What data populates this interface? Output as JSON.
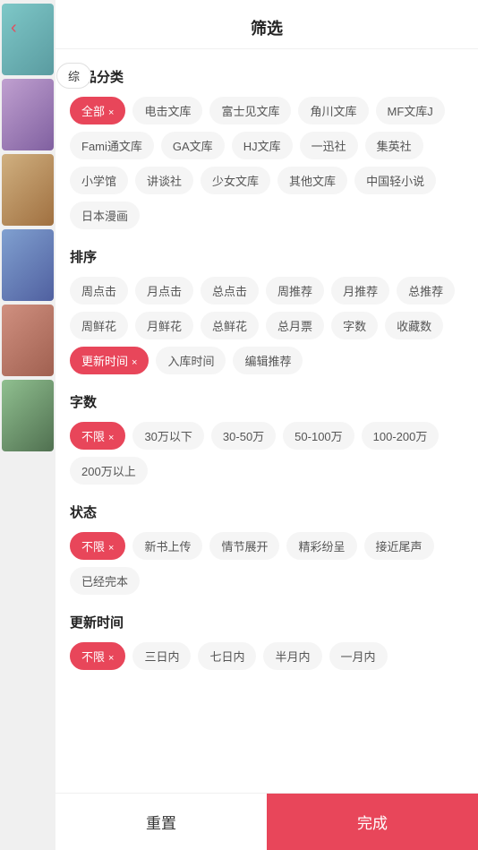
{
  "header": {
    "title": "筛选",
    "back_icon": "‹"
  },
  "sections": {
    "category": {
      "title": "作品分类",
      "tags": [
        {
          "label": "全部",
          "active": true,
          "has_close": true
        },
        {
          "label": "电击文库",
          "active": false
        },
        {
          "label": "富士见文库",
          "active": false
        },
        {
          "label": "角川文库",
          "active": false
        },
        {
          "label": "MF文库J",
          "active": false
        },
        {
          "label": "Fami通文库",
          "active": false
        },
        {
          "label": "GA文库",
          "active": false
        },
        {
          "label": "HJ文库",
          "active": false
        },
        {
          "label": "一迅社",
          "active": false
        },
        {
          "label": "集英社",
          "active": false
        },
        {
          "label": "小学馆",
          "active": false
        },
        {
          "label": "讲谈社",
          "active": false
        },
        {
          "label": "少女文库",
          "active": false
        },
        {
          "label": "其他文库",
          "active": false
        },
        {
          "label": "中国轻小说",
          "active": false
        },
        {
          "label": "日本漫画",
          "active": false
        }
      ]
    },
    "sort": {
      "title": "排序",
      "tags": [
        {
          "label": "周点击",
          "active": false
        },
        {
          "label": "月点击",
          "active": false
        },
        {
          "label": "总点击",
          "active": false
        },
        {
          "label": "周推荐",
          "active": false
        },
        {
          "label": "月推荐",
          "active": false
        },
        {
          "label": "总推荐",
          "active": false
        },
        {
          "label": "周鲜花",
          "active": false
        },
        {
          "label": "月鲜花",
          "active": false
        },
        {
          "label": "总鲜花",
          "active": false
        },
        {
          "label": "总月票",
          "active": false
        },
        {
          "label": "字数",
          "active": false
        },
        {
          "label": "收藏数",
          "active": false
        },
        {
          "label": "更新时间",
          "active": true,
          "has_close": true
        },
        {
          "label": "入库时间",
          "active": false
        },
        {
          "label": "编辑推荐",
          "active": false
        }
      ]
    },
    "word_count": {
      "title": "字数",
      "tags": [
        {
          "label": "不限",
          "active": true,
          "has_close": true
        },
        {
          "label": "30万以下",
          "active": false
        },
        {
          "label": "30-50万",
          "active": false
        },
        {
          "label": "50-100万",
          "active": false
        },
        {
          "label": "100-200万",
          "active": false
        },
        {
          "label": "200万以上",
          "active": false
        }
      ]
    },
    "status": {
      "title": "状态",
      "tags": [
        {
          "label": "不限",
          "active": true,
          "has_close": true
        },
        {
          "label": "新书上传",
          "active": false
        },
        {
          "label": "情节展开",
          "active": false
        },
        {
          "label": "精彩纷呈",
          "active": false
        },
        {
          "label": "接近尾声",
          "active": false
        },
        {
          "label": "已经完本",
          "active": false
        }
      ]
    },
    "update_time": {
      "title": "更新时间",
      "tags": [
        {
          "label": "不限",
          "active": true,
          "has_close": true
        },
        {
          "label": "三日内",
          "active": false
        },
        {
          "label": "七日内",
          "active": false
        },
        {
          "label": "半月内",
          "active": false
        },
        {
          "label": "一月内",
          "active": false
        }
      ]
    }
  },
  "footer": {
    "reset_label": "重置",
    "confirm_label": "完成"
  },
  "sidebar_tab": "综",
  "close_symbol": "×"
}
